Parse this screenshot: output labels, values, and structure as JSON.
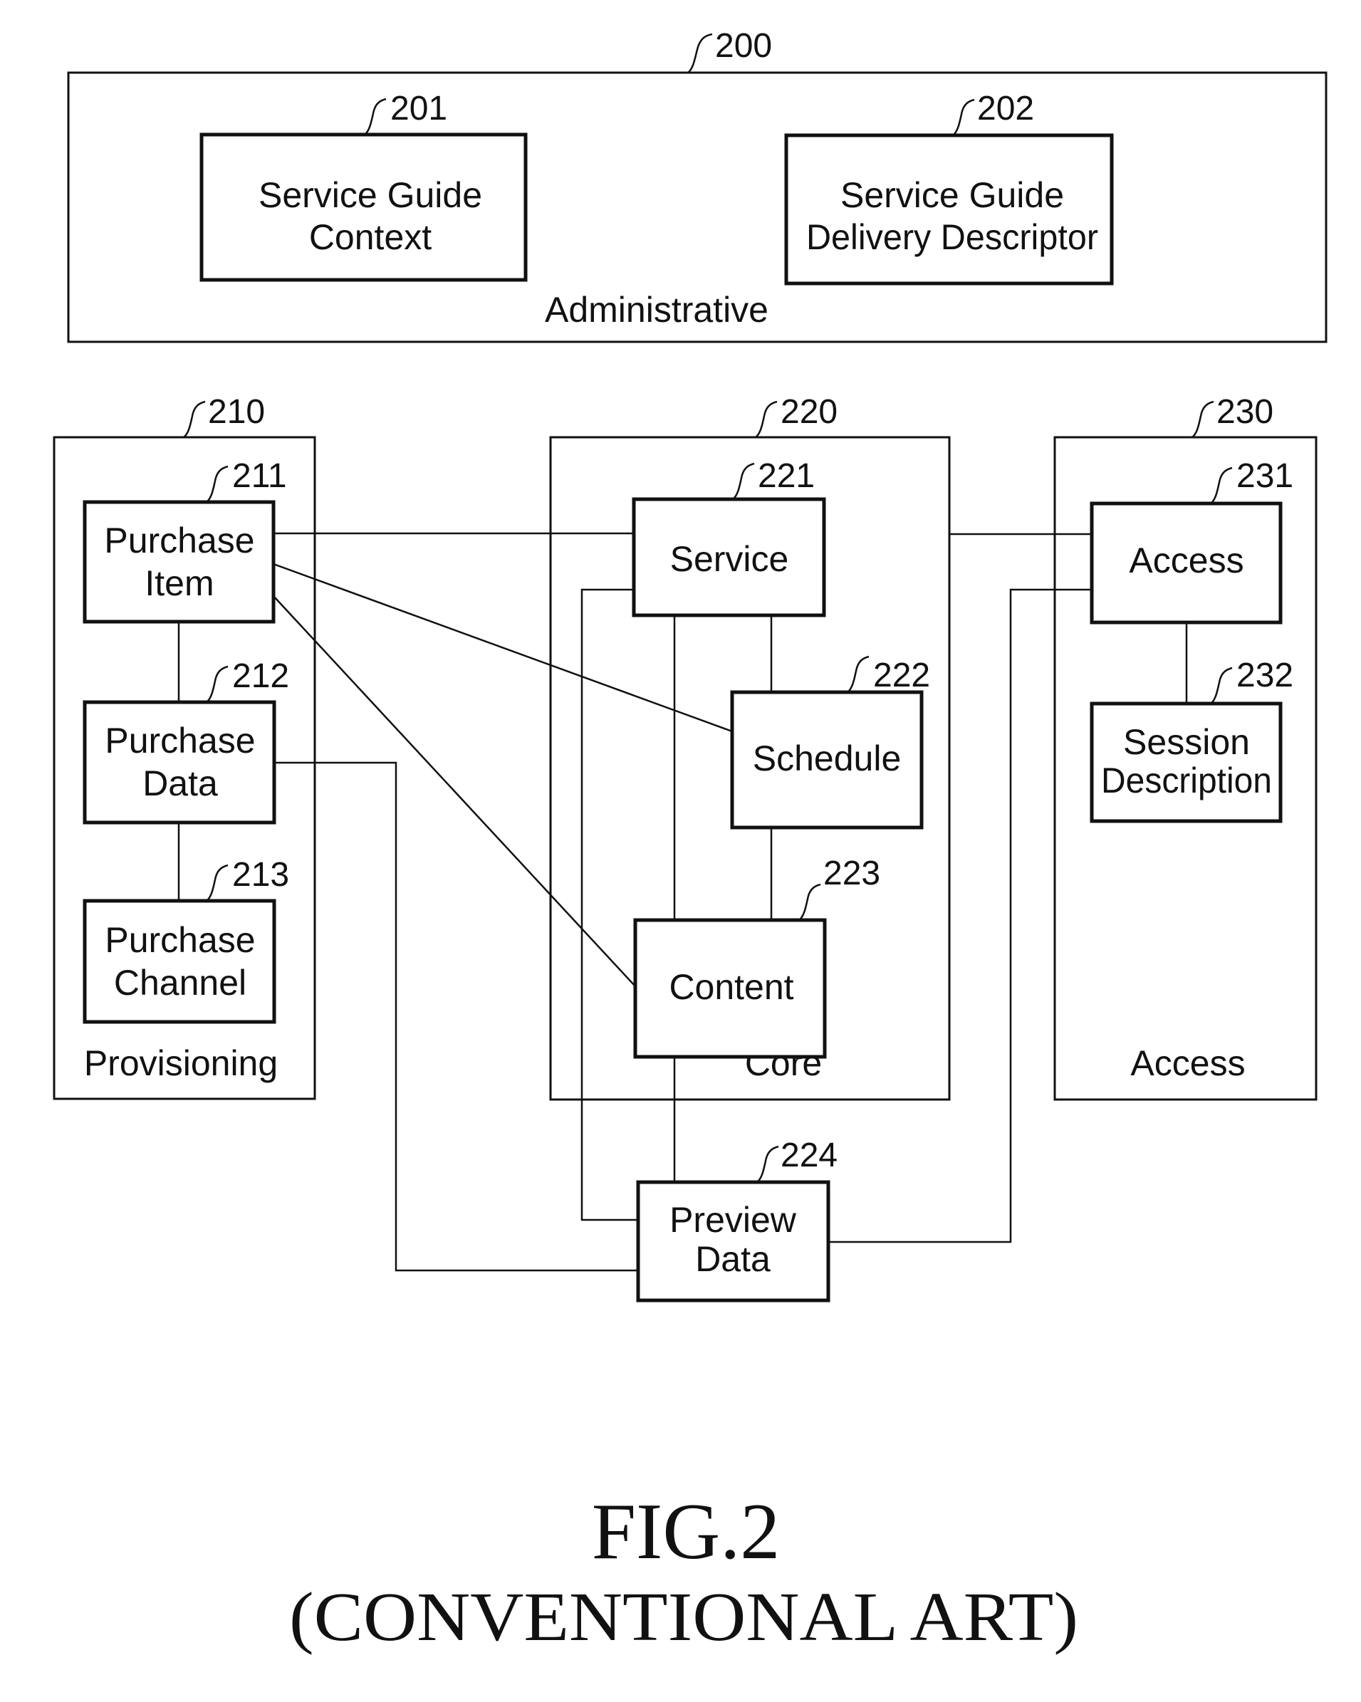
{
  "figure": {
    "title": "FIG.2",
    "subtitle": "(CONVENTIONAL ART)"
  },
  "groups": {
    "administrative": {
      "ref": "200",
      "label": "Administrative"
    },
    "provisioning": {
      "ref": "210",
      "label": "Provisioning"
    },
    "core": {
      "ref": "220",
      "label": "Core"
    },
    "access": {
      "ref": "230",
      "label": "Access"
    }
  },
  "nodes": {
    "service_guide_context": {
      "ref": "201",
      "lines": [
        "Service Guide",
        "Context"
      ]
    },
    "service_guide_delivery_descriptor": {
      "ref": "202",
      "lines": [
        "Service Guide",
        "Delivery Descriptor"
      ]
    },
    "purchase_item": {
      "ref": "211",
      "lines": [
        "Purchase",
        "Item"
      ]
    },
    "purchase_data": {
      "ref": "212",
      "lines": [
        "Purchase",
        "Data"
      ]
    },
    "purchase_channel": {
      "ref": "213",
      "lines": [
        "Purchase",
        "Channel"
      ]
    },
    "service": {
      "ref": "221",
      "lines": [
        "Service"
      ]
    },
    "schedule": {
      "ref": "222",
      "lines": [
        "Schedule"
      ]
    },
    "content": {
      "ref": "223",
      "lines": [
        "Content"
      ]
    },
    "preview_data": {
      "ref": "224",
      "lines": [
        "Preview",
        "Data"
      ]
    },
    "access": {
      "ref": "231",
      "lines": [
        "Access"
      ]
    },
    "session_description": {
      "ref": "232",
      "lines": [
        "Session",
        "Description"
      ]
    }
  },
  "connections": [
    {
      "from": "purchase_item",
      "to": "service"
    },
    {
      "from": "purchase_item",
      "to": "schedule"
    },
    {
      "from": "purchase_item",
      "to": "content"
    },
    {
      "from": "purchase_item",
      "to": "purchase_data"
    },
    {
      "from": "purchase_data",
      "to": "purchase_channel"
    },
    {
      "from": "purchase_data",
      "to": "preview_data"
    },
    {
      "from": "service",
      "to": "schedule"
    },
    {
      "from": "service",
      "to": "content"
    },
    {
      "from": "service",
      "to": "preview_data"
    },
    {
      "from": "schedule",
      "to": "content"
    },
    {
      "from": "content",
      "to": "preview_data"
    },
    {
      "from": "core",
      "to": "access"
    },
    {
      "from": "access",
      "to": "preview_data"
    },
    {
      "from": "access",
      "to": "session_description"
    }
  ]
}
